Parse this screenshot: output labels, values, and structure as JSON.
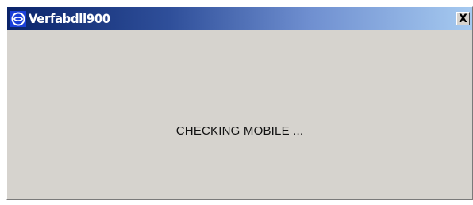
{
  "window": {
    "title": "Verfabdll900",
    "close_label": "X",
    "icon": "app-logo-icon",
    "title_gradient_start": "#0a246a",
    "title_gradient_end": "#a6caf0",
    "background": "#d6d3ce"
  },
  "content": {
    "status": "CHECKING MOBILE ..."
  }
}
